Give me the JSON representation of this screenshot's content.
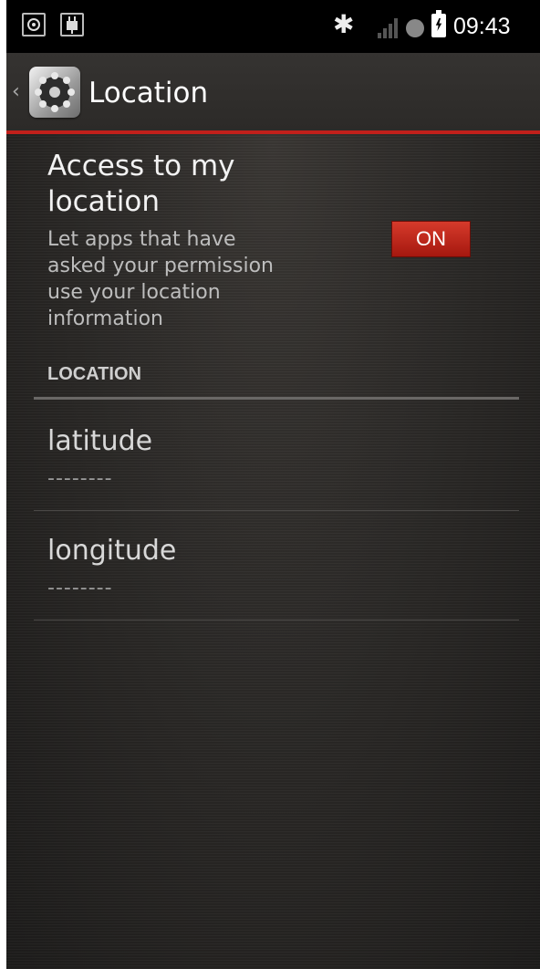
{
  "status_bar": {
    "time": "09:43",
    "left_icons": [
      "gps-icon",
      "usb-debug-icon"
    ],
    "right_icons": [
      "bluetooth-icon",
      "signal-icon",
      "sync-icon",
      "battery-charging-icon"
    ]
  },
  "action_bar": {
    "title": "Location",
    "icon": "settings-gear-icon"
  },
  "access": {
    "title": "Access to my location",
    "summary": "Let apps that have asked your permission use your location information",
    "toggle_label": "ON"
  },
  "section": {
    "header": "LOCATION"
  },
  "prefs": [
    {
      "title": "latitude",
      "value": "--------"
    },
    {
      "title": "longitude",
      "value": "--------"
    }
  ],
  "colors": {
    "accent": "#c1201b",
    "background": "#2a2826"
  }
}
